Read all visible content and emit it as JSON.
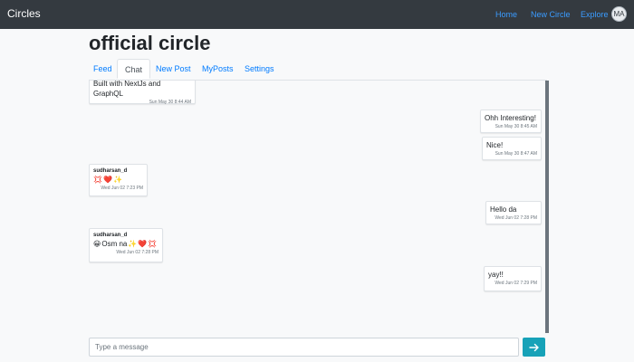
{
  "navbar": {
    "brand": "Circles",
    "links": [
      "Home",
      "New Circle",
      "Explore"
    ],
    "avatar_initials": "MA"
  },
  "page": {
    "title": "official circle"
  },
  "tabs": [
    {
      "label": "Feed",
      "active": false
    },
    {
      "label": "Chat",
      "active": true
    },
    {
      "label": "New Post",
      "active": false
    },
    {
      "label": "MyPosts",
      "active": false
    },
    {
      "label": "Settings",
      "active": false
    }
  ],
  "messages": [
    {
      "side": "left",
      "sender": "",
      "text": "Built with NextJs and GraphQL",
      "time": "Sun May 30 8:44 AM"
    },
    {
      "side": "right",
      "text": "Ohh Interesting!",
      "time": "Sun May 30 8:45 AM"
    },
    {
      "side": "right",
      "text": "Nice!",
      "time": "Sun May 30 8:47 AM"
    },
    {
      "side": "left",
      "sender": "sudharsan_d",
      "emojis": [
        "💢",
        "❤️",
        "✨"
      ],
      "time": "Wed Jun 02 7:23 PM"
    },
    {
      "side": "right",
      "text": "Hello da",
      "time": "Wed Jun 02 7:28 PM"
    },
    {
      "side": "left",
      "sender": "sudharsan_d",
      "emoji_prefix": "😀",
      "text": "Osm na",
      "emojis": [
        "✨",
        "❤️",
        "💢"
      ],
      "time": "Wed Jun 02 7:28 PM"
    },
    {
      "side": "right",
      "text": "yay!!",
      "time": "Wed Jun 02 7:29 PM"
    }
  ],
  "composer": {
    "placeholder": "Type a message",
    "send_icon": "arrow-right-icon"
  },
  "colors": {
    "navbar": "#343a40",
    "link": "#007bff",
    "send_button": "#17a2b8"
  }
}
